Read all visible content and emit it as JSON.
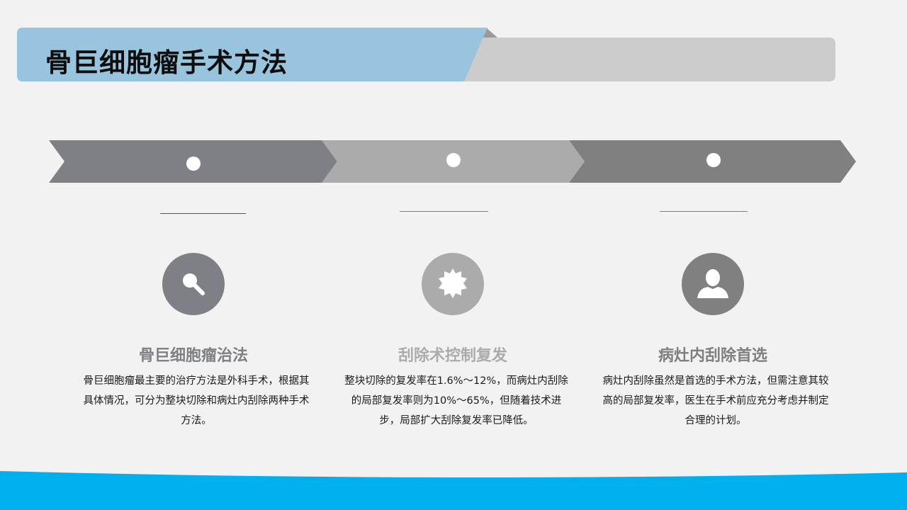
{
  "title": "骨巨细胞瘤手术方法",
  "colors": {
    "background": "#f2f2f2",
    "title_blue": "#98c5dd",
    "title_gray": "#cccccc",
    "step1": "#7e8085",
    "step2": "#ababab",
    "step3": "#808080",
    "accent_blue": "#00b0ec"
  },
  "columns": [
    {
      "icon": "search-icon",
      "heading": "骨巨细胞瘤治法",
      "body": "骨巨细胞瘤最主要的治疗方法是外科手术，根据其具体情况，可分为整块切除和病灶内刮除两种手术方法。"
    },
    {
      "icon": "gear-icon",
      "heading": "刮除术控制复发",
      "body": "整块切除的复发率在1.6%～12%，而病灶内刮除的局部复发率则为10%～65%，但随着技术进步，局部扩大刮除复发率已降低。"
    },
    {
      "icon": "user-icon",
      "heading": "病灶内刮除首选",
      "body": "病灶内刮除虽然是首选的手术方法，但需注意其较高的局部复发率，医生在手术前应充分考虑并制定合理的计划。"
    }
  ]
}
